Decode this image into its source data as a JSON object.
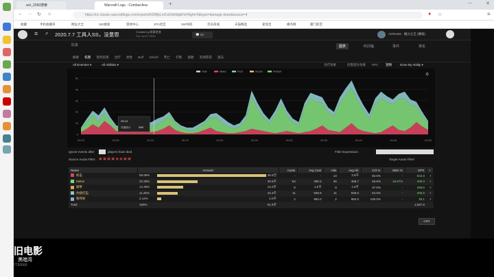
{
  "browser": {
    "tabs": [
      {
        "label": "wcl_2050搜索"
      },
      {
        "label": "Warcraft Logs - Combat Ana"
      }
    ],
    "url": "https://cn.classic.warcraftlogs.com/reports/KDMjkLmCeDdnMgbHr/#fight=5&type=damage-done&source=4",
    "bookmarks": [
      "收藏",
      "手机收藏夹",
      "网址大全",
      "360搜索",
      "游戏中心",
      "JPG社区",
      "360导航",
      "京东商城",
      "天猫精选",
      "爱淘宝",
      "蜂鸟网",
      "厦门航空"
    ]
  },
  "site": {
    "report_title": "2020.7.7 工具人SS，没意思",
    "created_by": "Created by 醉意逆流",
    "date": "Tue Jul 07 2020",
    "comment_count": "20",
    "character": "ACRUSS · 维沙之王 (硬核)",
    "nav_right": [
      "图表",
      "时间轴",
      "事件",
      "排名"
    ],
    "nav_left_label": "队友",
    "subtabs": [
      "摘要",
      "伤害",
      "受到伤害",
      "治疗",
      "抗性",
      "Buff",
      "Debuff",
      "死亡",
      "打断",
      "驱散",
      "资源获得",
      "施法"
    ],
    "filters": {
      "all_enemies": "All Enemies ▾",
      "all_abilities": "All Abilities ▾",
      "options": [
        "治疗效果",
        "伤害提升效果",
        "NPC",
        "宠物"
      ],
      "done_by": "Done By Ability ▾"
    },
    "ignore_events": "Ignore events after",
    "players_dead": "players have died",
    "filter_expression": "Filter Expression:",
    "source_auras": "Source Auras Filter:",
    "target_auras": "Target Auras Filter:",
    "csv_button": "CSV"
  },
  "chart_data": {
    "type": "area",
    "x_ticks": [
      "00:00",
      "00:05",
      "00:10",
      "00:15",
      "00:20",
      "00:25",
      "00:30",
      "00:35",
      "00:40",
      "00:45",
      "00:50"
    ],
    "y_ticks": [
      "0",
      "1k",
      "2k",
      "3k",
      "4k",
      "5k"
    ],
    "legend": [
      "Total",
      "Melee",
      "Frost",
      "Arcane",
      "Fireball"
    ],
    "tooltip": {
      "time": "00:14",
      "label": "伤害统计",
      "value": "542"
    },
    "series": [
      {
        "name": "Melee",
        "color": "#d9455f",
        "values": [
          0.2,
          0.5,
          0.9,
          0.6,
          1.2,
          0.8,
          0.3,
          0.2,
          0.4,
          0.6,
          0.5,
          0.3,
          0.2,
          0.3,
          0.5,
          0.8,
          0.4,
          0.2,
          0.1,
          0.1,
          0.2,
          0.4,
          0.6,
          0.3,
          0.2,
          0.1,
          0.1,
          0.2,
          0.3,
          0.5,
          0.4,
          0.3,
          0.2,
          0.1,
          0.2,
          0.3,
          0.2,
          0.1,
          0.2,
          0.3,
          0.5,
          0.8,
          0.4,
          0.3,
          0.2,
          0.6,
          1.0,
          0.5,
          0.3,
          0.2,
          0.1,
          0.2,
          0.5,
          0.8,
          0.4,
          0.3,
          0.6,
          1.1,
          0.7,
          0.4
        ]
      },
      {
        "name": "Frost",
        "color": "#7fd67a",
        "values": [
          0.3,
          0.6,
          0.8,
          0.5,
          0.7,
          0.4,
          0.3,
          0.2,
          0.4,
          0.5,
          0.6,
          0.4,
          0.5,
          0.6,
          0.7,
          0.9,
          0.6,
          0.4,
          0.3,
          0.2,
          0.4,
          0.6,
          0.9,
          1.2,
          0.8,
          0.6,
          0.4,
          0.5,
          1.0,
          2.8,
          1.9,
          1.2,
          0.8,
          1.6,
          2.5,
          1.4,
          0.9,
          0.7,
          2.2,
          2.9,
          2.4,
          2.0,
          1.6,
          1.3,
          2.6,
          2.9,
          3.1,
          2.5,
          1.8,
          1.2,
          2.6,
          3.0,
          2.4,
          1.9,
          2.7,
          2.9,
          2.0,
          1.4,
          1.0,
          0.6
        ]
      },
      {
        "name": "Arcane",
        "color": "#8cc6c9",
        "values": [
          0.1,
          0.3,
          0.4,
          0.6,
          0.5,
          0.3,
          0.2,
          0.2,
          0.3,
          0.3,
          0.2,
          0.3,
          0.4,
          0.5,
          0.4,
          0.3,
          0.2,
          0.2,
          0.2,
          0.3,
          0.3,
          0.2,
          0.3,
          0.4,
          0.5,
          0.4,
          0.3,
          0.3,
          0.4,
          0.6,
          0.5,
          0.4,
          0.3,
          0.4,
          0.5,
          0.4,
          0.3,
          0.3,
          0.4,
          0.5,
          0.6,
          0.5,
          0.4,
          0.4,
          0.5,
          0.6,
          0.7,
          0.6,
          0.5,
          0.4,
          0.5,
          0.6,
          0.5,
          0.4,
          0.5,
          0.6,
          0.5,
          0.4,
          0.3,
          0.2
        ]
      }
    ]
  },
  "table": {
    "headers": [
      "Name",
      "Amount",
      "Casts",
      "Avg Cast",
      "Hits",
      "Avg Hit",
      "Crit %",
      "Miss %",
      "DPS"
    ],
    "rows": [
      {
        "name": "射击",
        "color": "#d9455f",
        "pct": "59.99%",
        "share": 0.5999,
        "amount": "45.9万",
        "casts": "-",
        "avgcast": "-",
        "hits": "13",
        "avghit": "3.5千",
        "crit": "84.6%",
        "miss": "-",
        "dps": "816.8"
      },
      {
        "name": "Melee",
        "color": "#7fd67a",
        "pct": "22.39%",
        "share": 0.2239,
        "amount": "20.6千",
        "casts": "54",
        "avgcast": "380.5",
        "hits": "45",
        "avghit": "456.7",
        "crit": "46.6%",
        "miss": "16.67%",
        "dps": "409.3"
      },
      {
        "name": "献祭",
        "color": "#e0a050",
        "pct": "14.49%",
        "share": 0.1449,
        "amount": "13.3千",
        "casts": "8",
        "avgcast": "1.6千",
        "hits": "8",
        "avghit": "1.6千",
        "crit": "37.5%",
        "miss": "-",
        "dps": "258.6"
      },
      {
        "name": "灼烧打击",
        "color": "#8cc6c9",
        "pct": "11.25%",
        "share": 0.1125,
        "amount": "10.3千",
        "casts": "11",
        "avgcast": "936.6",
        "hits": "11",
        "avghit": "936.6",
        "crit": "54.5%",
        "miss": "-",
        "dps": "200.6"
      },
      {
        "name": "致死射",
        "color": "#9aa5d8",
        "pct": "2.14%",
        "share": 0.0214,
        "amount": "2.0千",
        "casts": "2",
        "avgcast": "982.0",
        "hits": "2",
        "avghit": "982.0",
        "crit": "100.0%",
        "miss": "-",
        "dps": "38.1"
      }
    ],
    "total": {
      "name": "Total",
      "pct": "100%",
      "amount": "91.8千",
      "dps": "1,837.8"
    }
  },
  "overlay": {
    "watermark": "旧电影",
    "watermark2": "黑暗湾",
    "badge": "7730000"
  }
}
